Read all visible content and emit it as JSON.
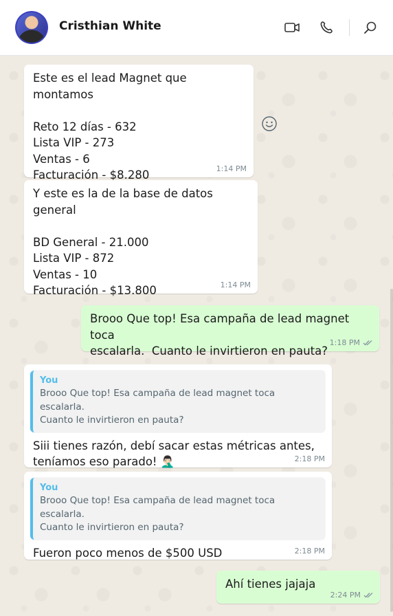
{
  "header": {
    "contact_name": "Cristhian White",
    "icons": [
      "video-call-icon",
      "voice-call-icon",
      "search-icon"
    ]
  },
  "colors": {
    "outgoing_bubble": "#d9fdd3",
    "incoming_bubble": "#ffffff",
    "quote_accent": "#53bdeb",
    "read_ticks": "#8696a0"
  },
  "messages": [
    {
      "direction": "in",
      "text": "Este es el lead Magnet que montamos\n\nReto 12 días - 632\nLista VIP - 273\nVentas - 6\nFacturación - $8.280",
      "time": "1:14 PM"
    },
    {
      "direction": "in",
      "text": "Y este es la de la base de datos general\n\nBD General - 21.000\nLista VIP - 872\nVentas - 10\nFacturación - $13.800",
      "time": "1:14 PM"
    },
    {
      "direction": "out",
      "text": "Brooo Que top! Esa campaña de lead magnet toca\nescalarla.  Cuanto le invirtieron en pauta?",
      "time": "1:18 PM",
      "status": "read"
    },
    {
      "direction": "in",
      "quote_author": "You",
      "quote_text": "Brooo Que top! Esa campaña de lead magnet toca escalarla.\nCuanto le invirtieron en pauta?",
      "text": "Siii tienes razón, debí sacar estas métricas antes,\nteníamos eso parado! 🤦🏻‍♂️",
      "time": "2:18 PM"
    },
    {
      "direction": "in",
      "quote_author": "You",
      "quote_text": "Brooo Que top! Esa campaña de lead magnet toca escalarla.\nCuanto le invirtieron en pauta?",
      "text": "Fueron poco menos de $500 USD",
      "time": "2:18 PM"
    },
    {
      "direction": "out",
      "text": "Ahí tienes jajaja",
      "time": "2:24 PM",
      "status": "read"
    }
  ]
}
